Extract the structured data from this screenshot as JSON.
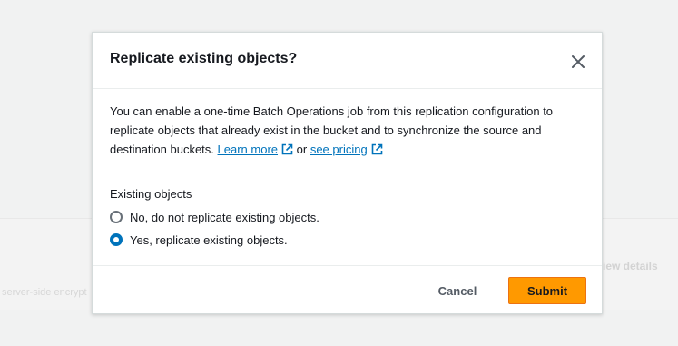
{
  "background": {
    "left_text": "server-side encrypt",
    "right_text": "iew details"
  },
  "modal": {
    "title": "Replicate existing objects?",
    "close_icon": "close-icon",
    "description": {
      "text_before": "You can enable a one-time Batch Operations job from this replication configuration to replicate objects that already exist in the bucket and to synchronize the source and destination buckets.",
      "learn_more": "Learn more",
      "or": "or",
      "see_pricing": "see pricing",
      "external_icon": "external-link-icon"
    },
    "field_label": "Existing objects",
    "options": [
      {
        "label": "No, do not replicate existing objects.",
        "selected": false
      },
      {
        "label": "Yes, replicate existing objects.",
        "selected": true
      }
    ],
    "footer": {
      "cancel_label": "Cancel",
      "submit_label": "Submit"
    }
  },
  "colors": {
    "link": "#0073bb",
    "primary_button": "#ff9900",
    "radio_selected": "#0073bb"
  }
}
